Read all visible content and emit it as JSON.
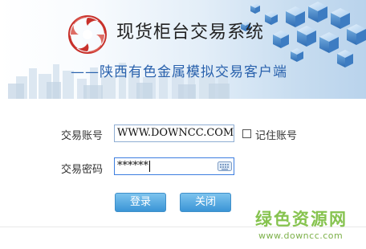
{
  "banner": {
    "title": "现货柜台交易系统",
    "subtitle": "——陕西有色金属模拟交易客户端"
  },
  "form": {
    "account_label": "交易账号",
    "account_value": "WWW.DOWNCC.COM",
    "password_label": "交易密码",
    "password_value": "******",
    "remember_label": "记住账号",
    "remember_checked": false
  },
  "buttons": {
    "login": "登录",
    "close": "关闭"
  },
  "watermark": {
    "text": "绿色资源网",
    "url": "www.downcc.com"
  },
  "colors": {
    "accent_blue": "#3a95d6",
    "subtitle_blue": "#2a62ad",
    "logo_red": "#c8312b",
    "watermark_green": "#86c34f"
  },
  "icons": {
    "logo": "swirl-logo",
    "keyboard": "keyboard-icon"
  }
}
